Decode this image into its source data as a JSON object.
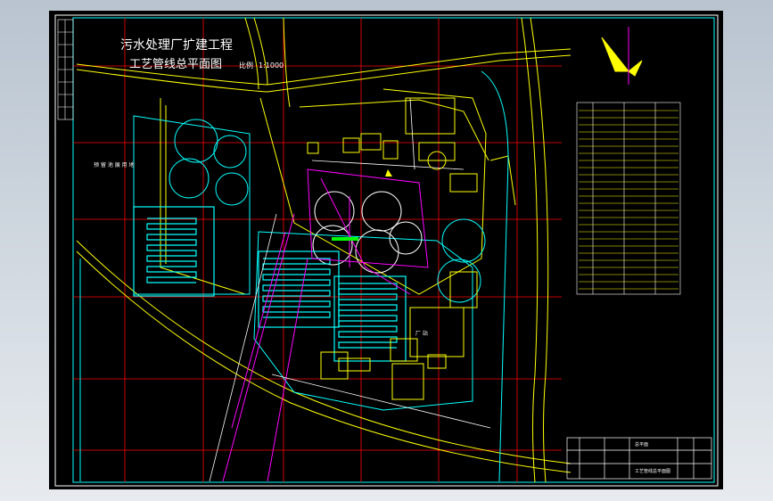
{
  "drawing": {
    "title_line1": "污水处理厂扩建工程",
    "title_line2": "工艺管线总平面图",
    "scale_label": "比例",
    "scale_value": "1:1000",
    "left_note": "预 留 池 展 用 地",
    "building_label": "厂 站",
    "title_block_name": "工艺管线总平面图",
    "title_block_top": "总平面"
  },
  "colors": {
    "background": "#000000",
    "gradient_top": "#b9c4d0",
    "gradient_bottom": "#e7ebef",
    "frame": "#ffffff",
    "inner_frame": "#00ffff",
    "grid": "#ff0000",
    "road": "#ffff00",
    "pipe_cyan": "#00ffff",
    "pipe_magenta": "#ff00ff",
    "pipe_white": "#ffffff",
    "accent_green": "#00ff00"
  }
}
